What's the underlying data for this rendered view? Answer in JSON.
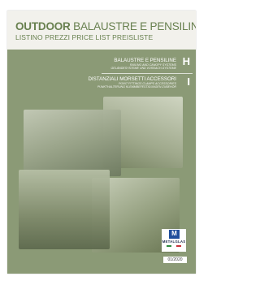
{
  "header": {
    "title_bold": "OUTDOOR",
    "title_rest": " BALAUSTRE E PENSILINE",
    "subtitle": "LISTINO PREZZI PRICE LIST PREISLISTE"
  },
  "categories": [
    {
      "letter": "H",
      "title": "BALAUSTRE E PENSILINE",
      "desc1": "RAILING AND CANOPY SYSTEMS",
      "desc2": "GELÄNDESYSTEME UND VORDACH-SYSTEME"
    },
    {
      "letter": "I",
      "title": "DISTANZIALI MORSETTI ACCESSORI",
      "desc1": "POINT FITTINGS CLAMPS ACCESSORIES",
      "desc2": "PUNKTHALTERUNG KLEMMBEFESTIGUNGEN ZUBEHÖR"
    }
  ],
  "brand": {
    "mark": "M",
    "name": "METALGLAS"
  },
  "edition": "01/2020",
  "colors": {
    "cover_green": "#8b9a76",
    "title_green": "#68804f",
    "header_bg": "#f2f1ec",
    "logo_blue": "#1f4e9c"
  }
}
